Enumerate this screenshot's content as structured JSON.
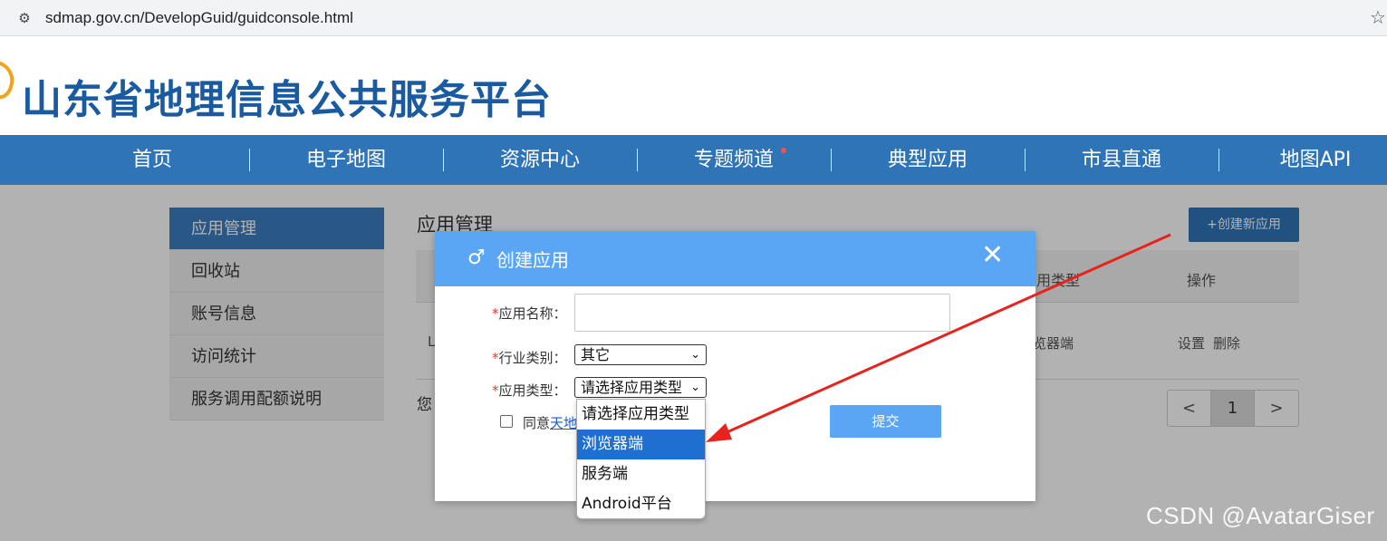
{
  "browser": {
    "url": "sdmap.gov.cn/DevelopGuid/guidconsole.html"
  },
  "site": {
    "title": "山东省地理信息公共服务平台"
  },
  "nav": {
    "items": [
      "首页",
      "电子地图",
      "资源中心",
      "专题频道",
      "典型应用",
      "市县直通",
      "地图API"
    ]
  },
  "sidebar": {
    "items": [
      "应用管理",
      "回收站",
      "账号信息",
      "访问统计",
      "服务调用配额说明"
    ]
  },
  "main": {
    "title": "应用管理",
    "new_button": "+创建新应用",
    "col_type": "用类型",
    "col_op": "操作",
    "row_prefix": "L",
    "row_type": "览器端",
    "row_set": "设置",
    "row_del": "删除",
    "footer_prefix": "您"
  },
  "pager": {
    "prev": "<",
    "current": "1",
    "next": ">"
  },
  "dialog": {
    "icon": "♂",
    "title": "创建应用",
    "close": "✕",
    "required_mark": "*",
    "name_label": "应用名称：",
    "industry_label": "行业类别：",
    "industry_value": "其它",
    "type_label": "应用类型：",
    "type_value": "请选择应用类型",
    "agree_text": "同意",
    "agree_link": "天地",
    "submit": "提交"
  },
  "dropdown": {
    "options": [
      "请选择应用类型",
      "浏览器端",
      "服务端",
      "Android平台"
    ],
    "highlighted_index": 1
  },
  "watermark": "CSDN @AvatarGiser",
  "colors": {
    "nav": "#2f74b6",
    "dialog_header": "#5aa6f5",
    "highlight": "#1f6fd1",
    "annotation_arrow": "#e8231d"
  }
}
